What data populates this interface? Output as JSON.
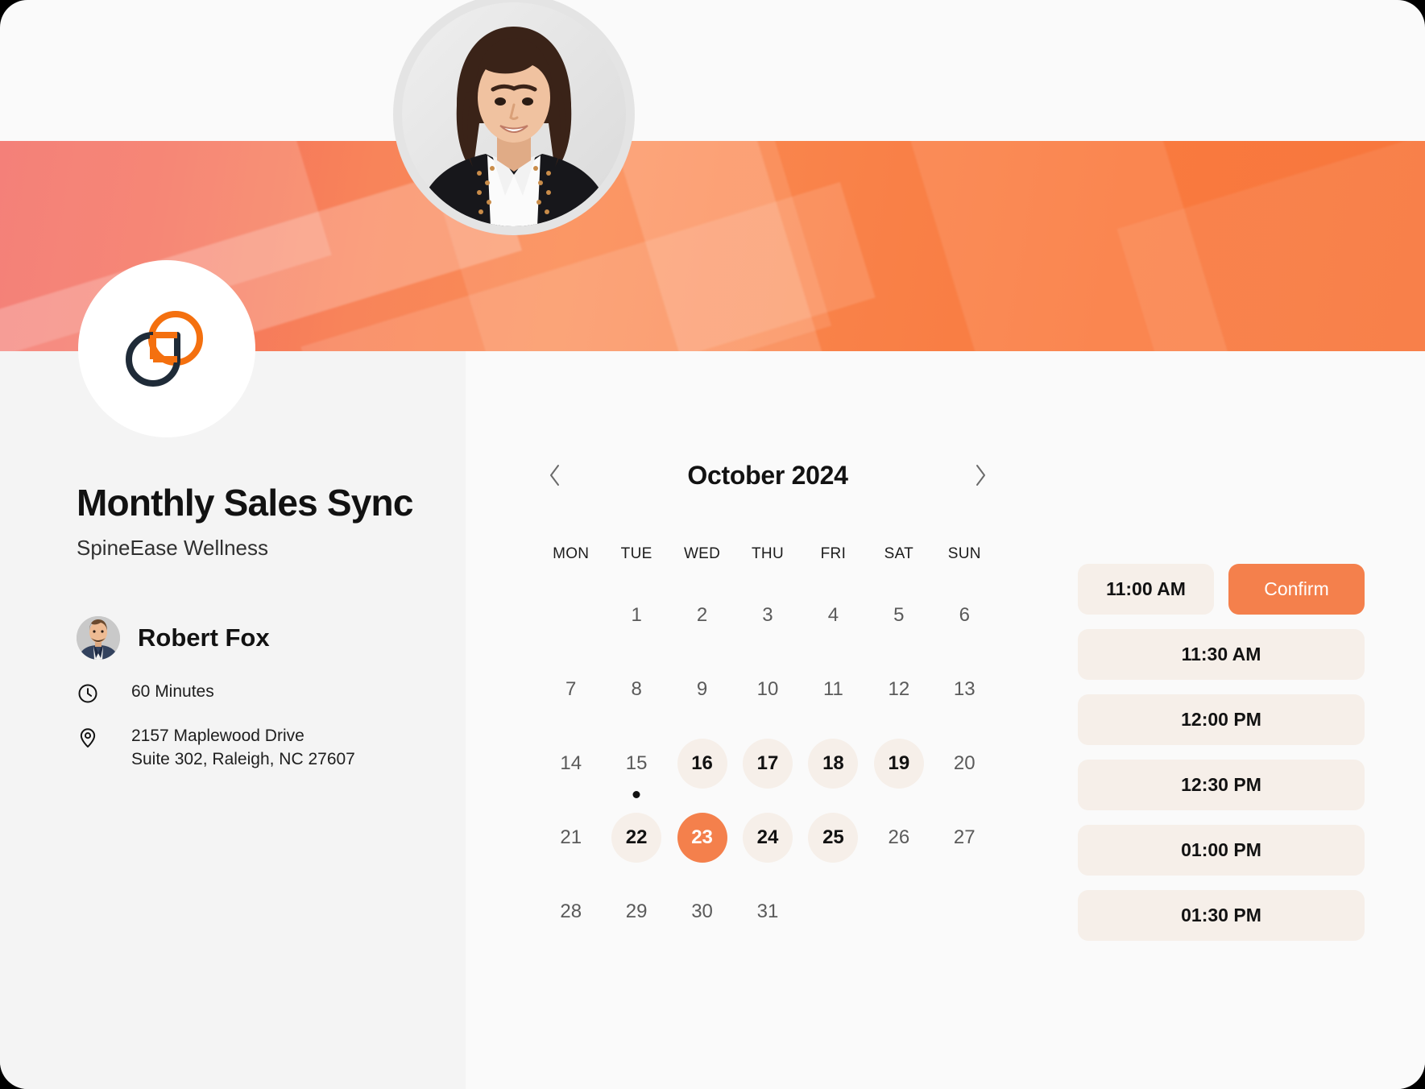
{
  "event": {
    "title": "Monthly Sales Sync",
    "organization": "SpineEase Wellness",
    "host_name": "Robert Fox",
    "duration": "60 Minutes",
    "address_line1": "2157 Maplewood Drive",
    "address_line2": "Suite 302, Raleigh, NC 27607"
  },
  "icons": {
    "clock": "clock-icon",
    "location": "map-pin-icon",
    "prev": "chevron-left-icon",
    "next": "chevron-right-icon",
    "logo": "brand-logo-icon",
    "avatar": "host-photo-avatar"
  },
  "calendar": {
    "month_label": "October 2024",
    "prev_label": "‹",
    "next_label": "›",
    "weekdays": [
      "MON",
      "TUE",
      "WED",
      "THU",
      "FRI",
      "SAT",
      "SUN"
    ],
    "leading_blanks": 1,
    "days": [
      {
        "n": "1",
        "state": "plain"
      },
      {
        "n": "2",
        "state": "plain"
      },
      {
        "n": "3",
        "state": "plain"
      },
      {
        "n": "4",
        "state": "plain"
      },
      {
        "n": "5",
        "state": "plain"
      },
      {
        "n": "6",
        "state": "plain"
      },
      {
        "n": "7",
        "state": "plain"
      },
      {
        "n": "8",
        "state": "plain"
      },
      {
        "n": "9",
        "state": "plain"
      },
      {
        "n": "10",
        "state": "plain"
      },
      {
        "n": "11",
        "state": "plain"
      },
      {
        "n": "12",
        "state": "plain"
      },
      {
        "n": "13",
        "state": "plain"
      },
      {
        "n": "14",
        "state": "plain"
      },
      {
        "n": "15",
        "state": "today"
      },
      {
        "n": "16",
        "state": "available"
      },
      {
        "n": "17",
        "state": "available"
      },
      {
        "n": "18",
        "state": "available"
      },
      {
        "n": "19",
        "state": "available"
      },
      {
        "n": "20",
        "state": "plain"
      },
      {
        "n": "21",
        "state": "plain"
      },
      {
        "n": "22",
        "state": "available"
      },
      {
        "n": "23",
        "state": "selected"
      },
      {
        "n": "24",
        "state": "available"
      },
      {
        "n": "25",
        "state": "available"
      },
      {
        "n": "26",
        "state": "plain"
      },
      {
        "n": "27",
        "state": "plain"
      },
      {
        "n": "28",
        "state": "plain"
      },
      {
        "n": "29",
        "state": "plain"
      },
      {
        "n": "30",
        "state": "plain"
      },
      {
        "n": "31",
        "state": "plain"
      }
    ]
  },
  "slots": {
    "selected_time": "11:00 AM",
    "confirm_label": "Confirm",
    "times": [
      "11:30 AM",
      "12:00 PM",
      "12:30 PM",
      "01:00 PM",
      "01:30 PM"
    ]
  },
  "colors": {
    "accent": "#f4804c",
    "accent_soft": "#f6efe9",
    "banner_start": "#f2685f",
    "banner_end": "#f8763c",
    "text_dark": "#121212",
    "logo_navy": "#1f2b38",
    "logo_orange": "#f4700f"
  }
}
